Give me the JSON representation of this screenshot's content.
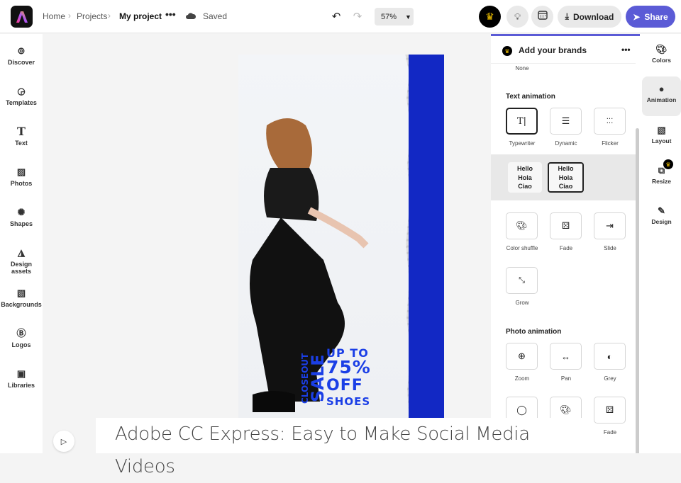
{
  "header": {
    "breadcrumbs": [
      "Home",
      "Projects",
      "My project"
    ],
    "saved": "Saved",
    "zoom": "57%",
    "download": "Download",
    "share": "Share"
  },
  "colors": {
    "accent": "#5b5bd6",
    "promo_blue": "#1b3fe6"
  },
  "left_sidebar": [
    "Discover",
    "Templates",
    "Text",
    "Photos",
    "Shapes",
    "Design assets",
    "Backgrounds",
    "Logos",
    "Libraries"
  ],
  "canvas": {
    "promo": {
      "closeout": "CLOSEOUT",
      "sale": "SALE",
      "line1": "UP TO",
      "line2": "75%",
      "line3": "OFF",
      "line4": "SHOES"
    }
  },
  "panel": {
    "title": "Add your brands",
    "none_label": "None",
    "text_animation": {
      "heading": "Text animation",
      "items": [
        "Typewriter",
        "Dynamic",
        "Flicker"
      ],
      "variant_text": [
        "Hello",
        "Hola",
        "Ciao"
      ]
    },
    "more_items": [
      "Color shuffle",
      "Fade",
      "Slide",
      "Grow"
    ],
    "photo_animation": {
      "heading": "Photo animation",
      "items": [
        "Zoom",
        "Pan",
        "Grey"
      ],
      "row2": [
        "Fade"
      ]
    }
  },
  "right_rail": [
    "Colors",
    "Animation",
    "Layout",
    "Resize",
    "Design"
  ],
  "caption": "Adobe CC Express: Easy to Make Social Media Videos"
}
